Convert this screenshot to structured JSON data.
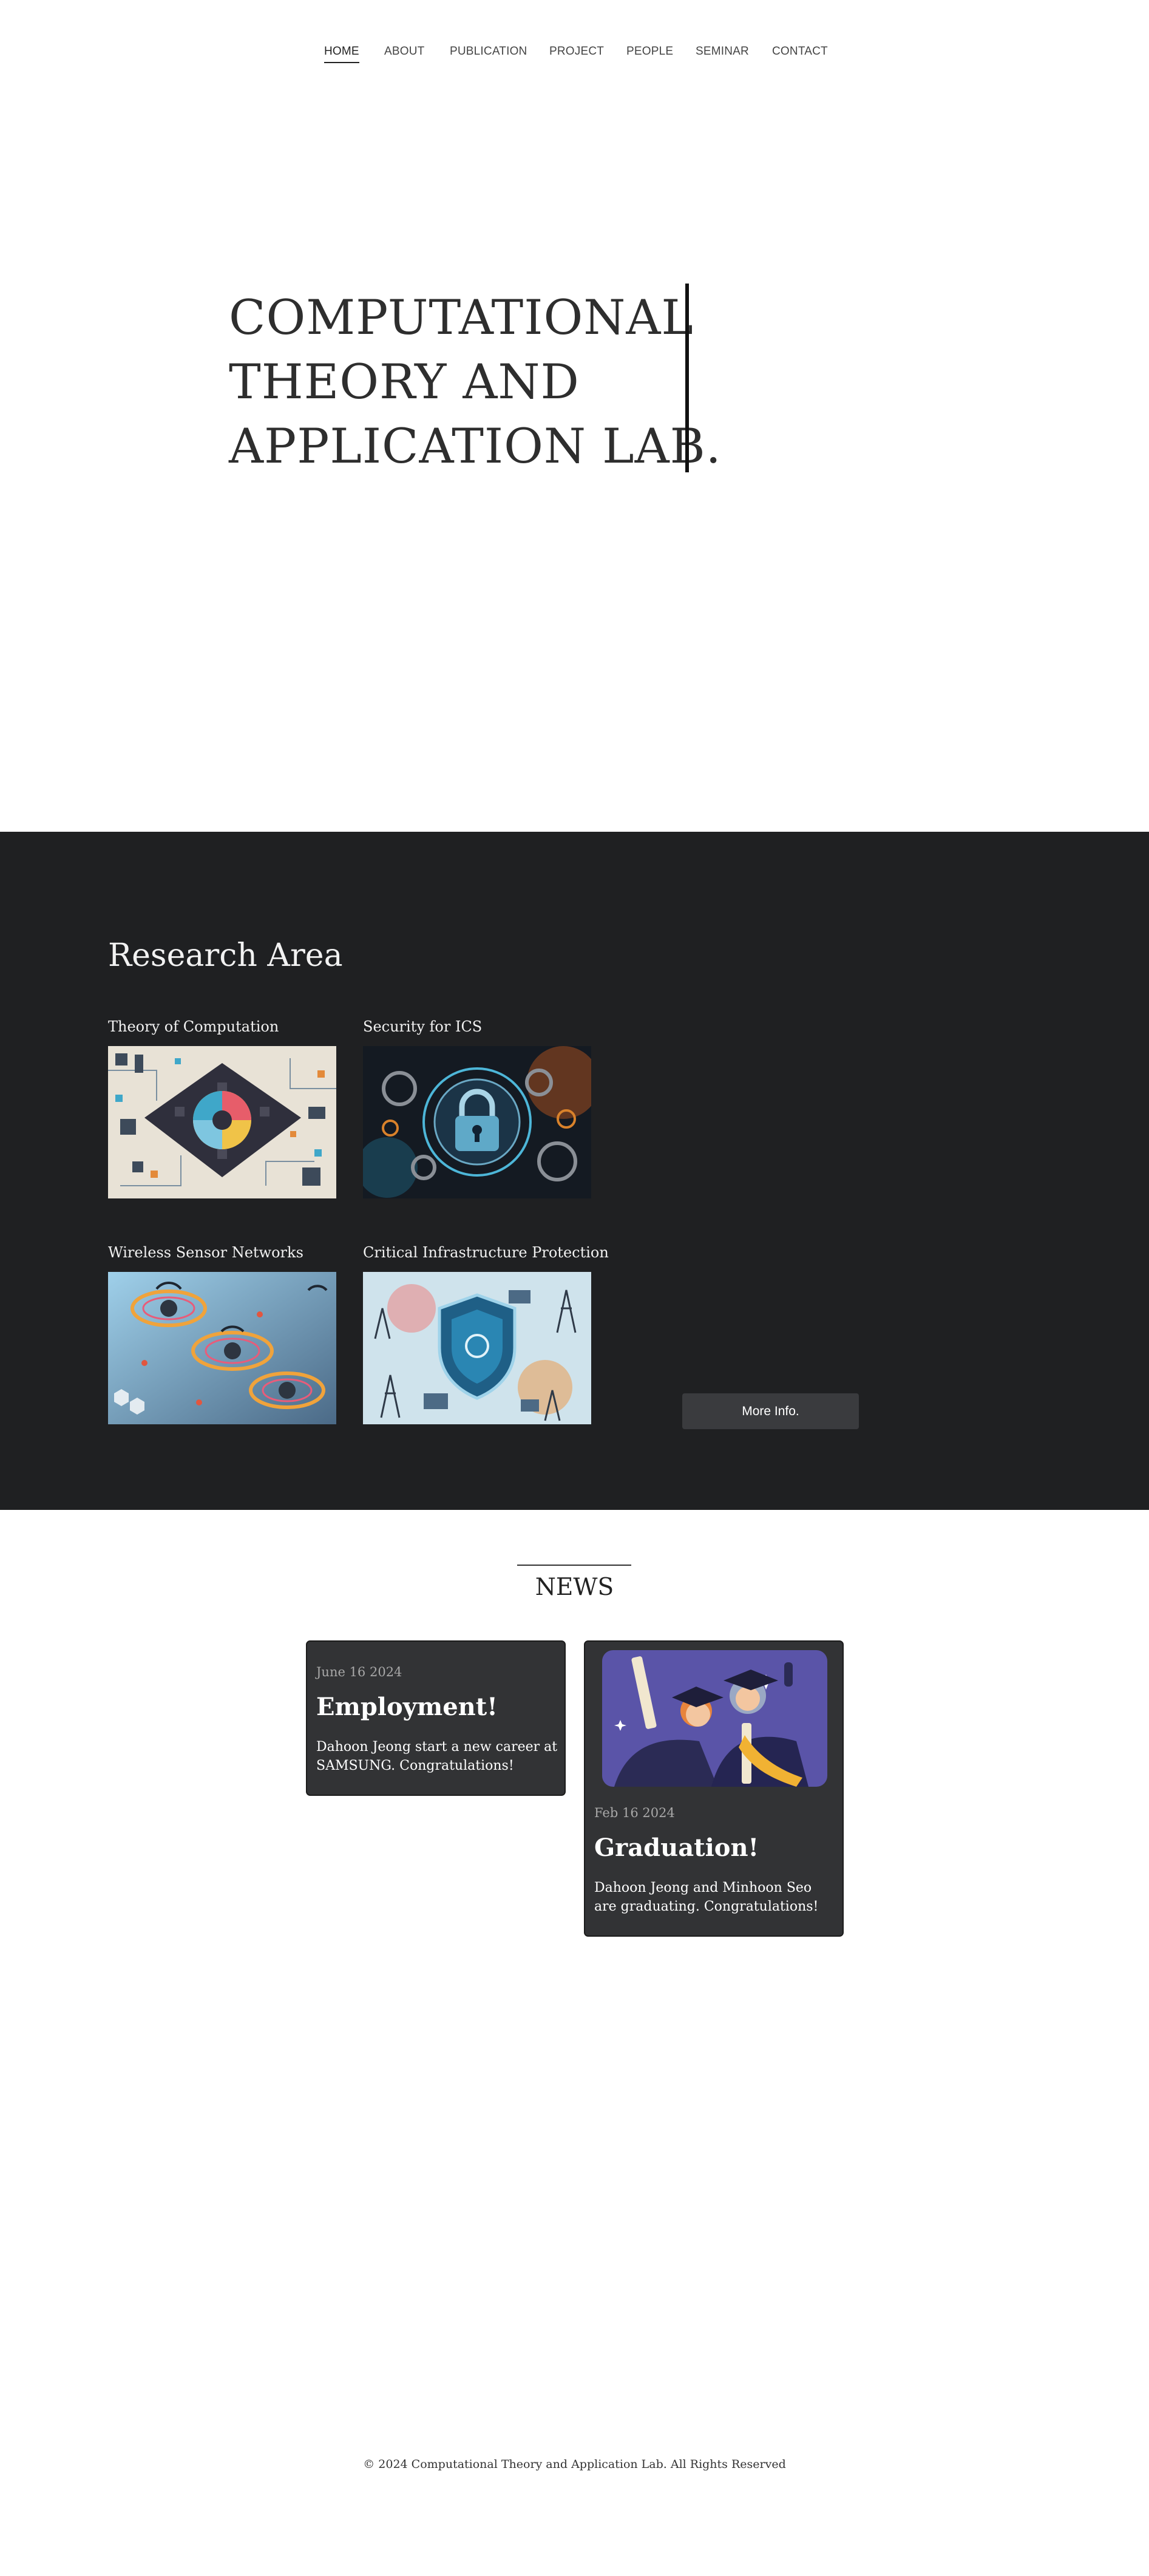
{
  "nav": {
    "items": [
      {
        "label": "HOME",
        "active": true
      },
      {
        "label": "ABOUT",
        "active": false
      },
      {
        "label": "PUBLICATION",
        "active": false
      },
      {
        "label": "PROJECT",
        "active": false
      },
      {
        "label": "PEOPLE",
        "active": false
      },
      {
        "label": "SEMINAR",
        "active": false
      },
      {
        "label": "CONTACT",
        "active": false
      }
    ]
  },
  "hero": {
    "lines": [
      "COMPUTATIONAL",
      "THEORY AND",
      "APPLICATION LAB."
    ]
  },
  "research": {
    "title": "Research Area",
    "areas": [
      {
        "label": "Theory of Computation",
        "image": "circuit-board-illustration"
      },
      {
        "label": "Security for ICS",
        "image": "padlock-gears-illustration"
      },
      {
        "label": "Wireless Sensor Networks",
        "image": "wireless-signal-illustration"
      },
      {
        "label": "Critical Infrastructure Protection",
        "image": "shield-power-grid-illustration"
      }
    ],
    "more_button": "More Info."
  },
  "news": {
    "title": "NEWS",
    "items": [
      {
        "date": "June 16 2024",
        "title": "Employment!",
        "text": "Dahoon Jeong start a new career at SAMSUNG. Congratulations!"
      },
      {
        "date": "Feb 16 2024",
        "title": "Graduation!",
        "text": "Dahoon Jeong and Minhoon Seo are graduating. Congratulations!",
        "image": "graduates-illustration"
      }
    ]
  },
  "footer": {
    "text": "© 2024 Computational Theory and Application Lab. All Rights Reserved"
  },
  "colors": {
    "dark_section": "#1f2022",
    "card_bg": "#323335",
    "button_bg": "#3a3b3e",
    "graduation_bg": "#5a54a8"
  }
}
